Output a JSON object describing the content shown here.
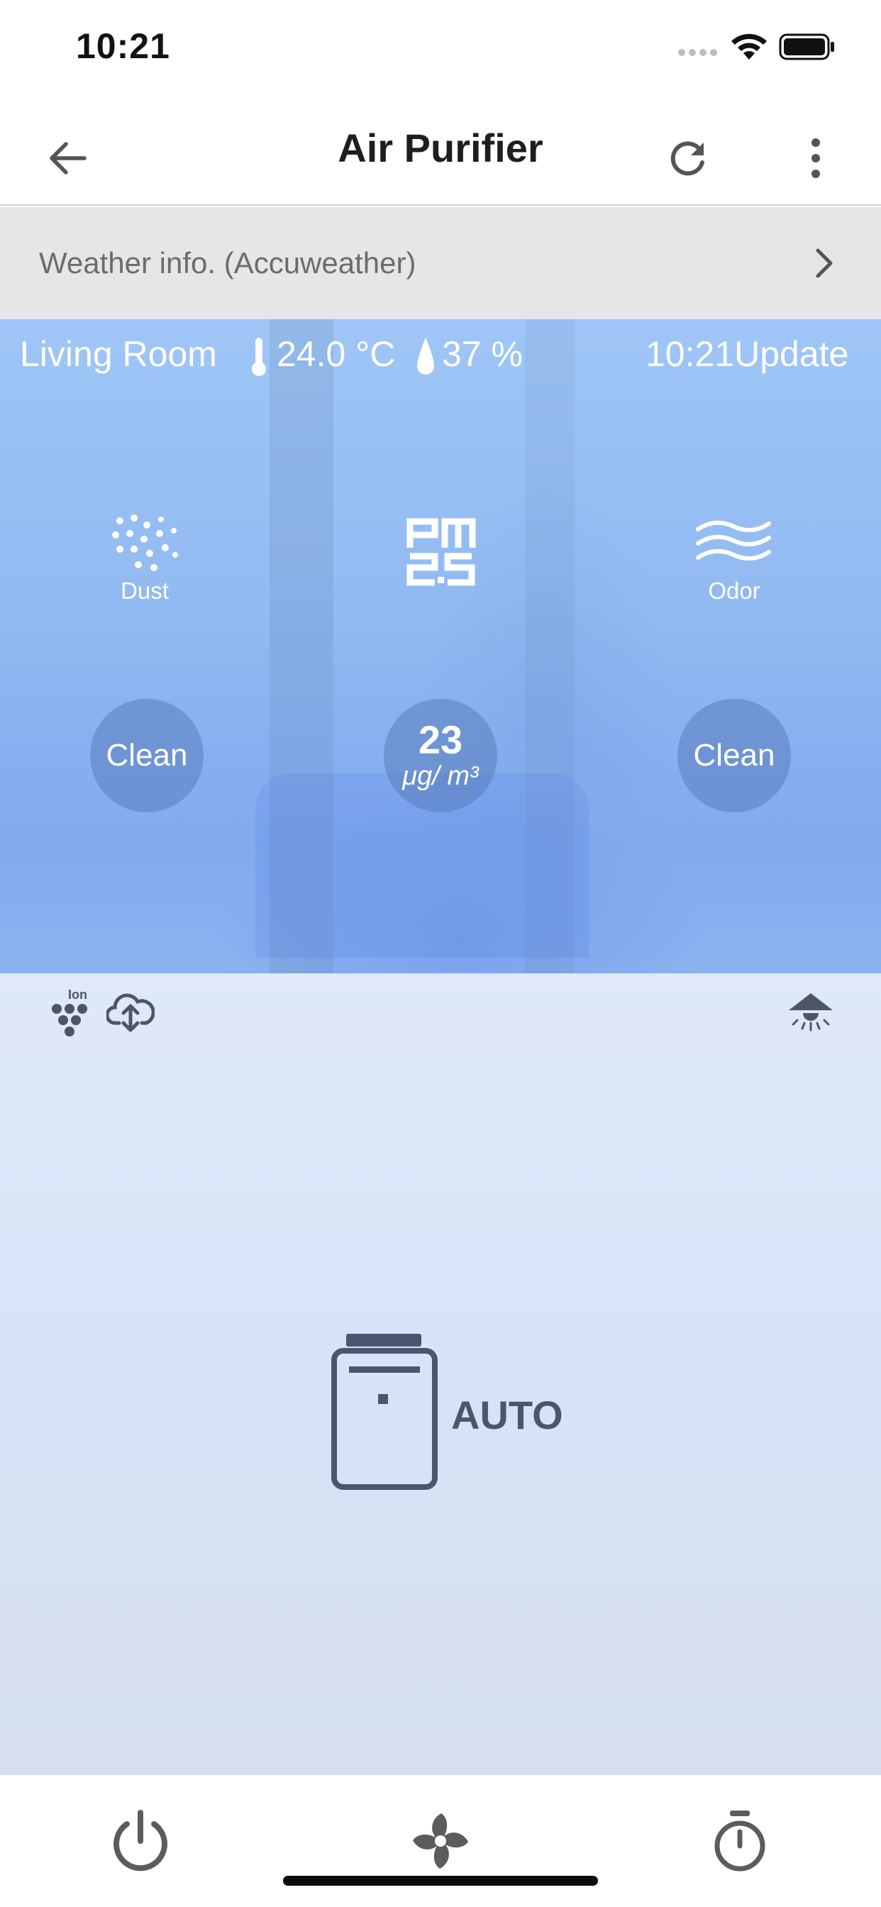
{
  "status_bar": {
    "time": "10:21",
    "signal_icon": "signal-dots-icon",
    "wifi_icon": "wifi-icon",
    "battery_icon": "battery-icon"
  },
  "nav": {
    "title": "Air Purifier",
    "back_icon": "arrow-left-icon",
    "refresh_icon": "refresh-icon",
    "more_icon": "more-vertical-icon"
  },
  "weather": {
    "label": "Weather info. (Accuweather)",
    "chevron_icon": "chevron-right-icon"
  },
  "room": {
    "name": "Living Room",
    "temperature": "24.0 °C",
    "humidity": "37 %",
    "update": "10:21Update"
  },
  "sensors": {
    "dust": {
      "caption": "Dust",
      "status": "Clean",
      "icon": "dust-icon"
    },
    "pm25": {
      "value": "23",
      "unit": "μg/ m³",
      "icon": "pm25-icon"
    },
    "odor": {
      "caption": "Odor",
      "status": "Clean",
      "icon": "odor-icon"
    }
  },
  "indicators": {
    "ion_label": "Ion",
    "ion_icon": "ion-icon",
    "cloud_icon": "cloud-sync-icon",
    "light_icon": "light-icon"
  },
  "device": {
    "mode": "AUTO",
    "icon": "purifier-icon"
  },
  "bottom_bar": {
    "power_icon": "power-icon",
    "fan_icon": "fan-icon",
    "timer_icon": "timer-icon"
  },
  "colors": {
    "panel_blue": "#93bbf2",
    "device_text": "#4a5670",
    "icon_gray": "#5c5c5c"
  }
}
